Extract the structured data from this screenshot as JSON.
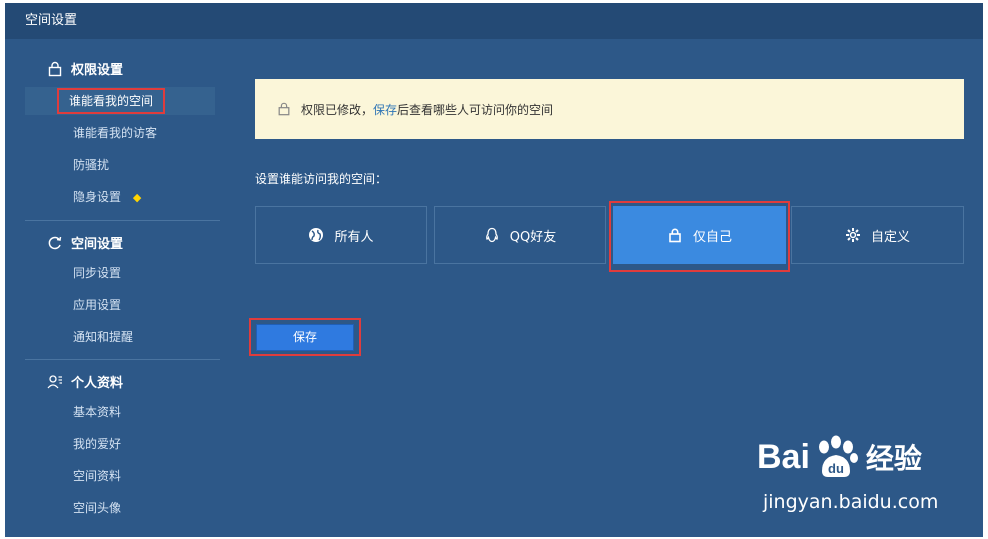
{
  "window": {
    "title": "空间设置"
  },
  "sidebar": {
    "groups": [
      {
        "icon": "lock-icon",
        "title": "权限设置",
        "items": [
          {
            "label": "谁能看我的空间",
            "active": true
          },
          {
            "label": "谁能看我的访客"
          },
          {
            "label": "防骚扰"
          },
          {
            "label": "隐身设置",
            "badge_icon": "diamond-icon"
          }
        ]
      },
      {
        "icon": "refresh-icon",
        "title": "空间设置",
        "items": [
          {
            "label": "同步设置"
          },
          {
            "label": "应用设置"
          },
          {
            "label": "通知和提醒"
          }
        ]
      },
      {
        "icon": "user-profile-icon",
        "title": "个人资料",
        "items": [
          {
            "label": "基本资料"
          },
          {
            "label": "我的爱好"
          },
          {
            "label": "空间资料"
          },
          {
            "label": "空间头像"
          }
        ]
      }
    ]
  },
  "notice": {
    "icon": "lock-icon",
    "text_before": "权限已修改，",
    "link": "保存",
    "text_after": "后查看哪些人可访问你的空间"
  },
  "access": {
    "prompt": "设置谁能访问我的空间：",
    "options": [
      {
        "label": "所有人",
        "icon": "globe-icon"
      },
      {
        "label": "QQ好友",
        "icon": "qq-penguin-icon"
      },
      {
        "label": "仅自己",
        "icon": "lock-icon",
        "selected": true
      },
      {
        "label": "自定义",
        "icon": "gear-icon"
      }
    ]
  },
  "save_button": "保存",
  "watermark": {
    "brand_left": "Bai",
    "brand_right": "经验",
    "url": "jingyan.baidu.com"
  },
  "colors": {
    "background": "#2d5888",
    "titlebar": "#244a75",
    "selected_option": "#3b8ae0",
    "highlight_box": "#e03c3c",
    "notice_bg": "#fbf6d9",
    "diamond": "#ffd400"
  }
}
